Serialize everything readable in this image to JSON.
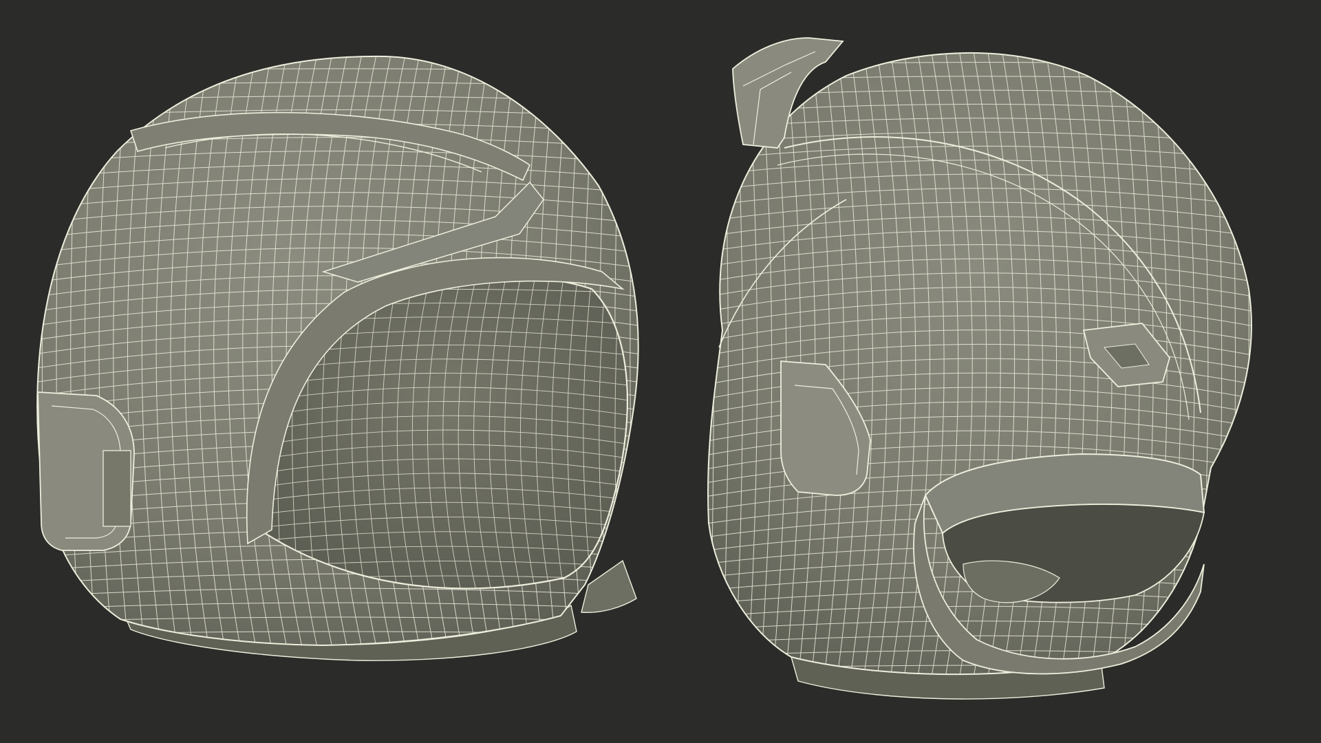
{
  "scene": {
    "background_color": "#2b2b29",
    "shell_color": "#7c7d70",
    "shell_shadow_color": "#5f6055",
    "wire_color": "#eeeedd",
    "objects": [
      {
        "name": "helmet-rear-three-quarter-view",
        "icon": "helmet-icon"
      },
      {
        "name": "helmet-front-three-quarter-view",
        "icon": "helmet-icon"
      }
    ]
  }
}
